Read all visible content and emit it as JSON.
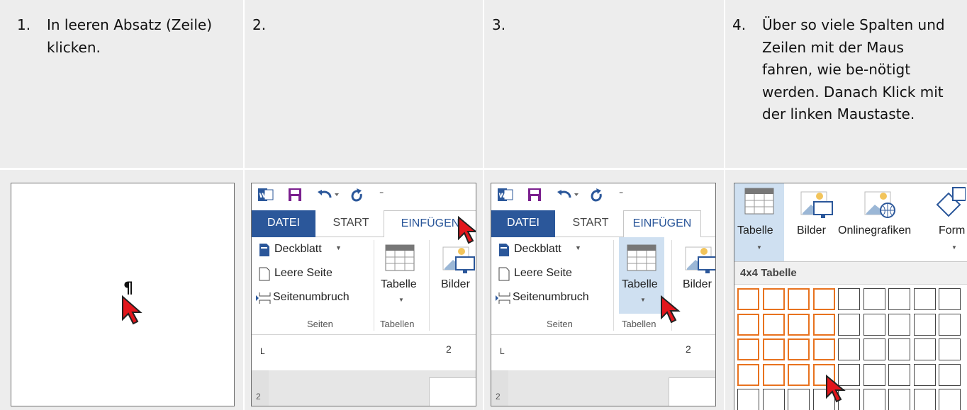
{
  "steps": [
    {
      "num": "1.",
      "text": "In leeren Absatz (Zeile) klicken."
    },
    {
      "num": "2.",
      "text": ""
    },
    {
      "num": "3.",
      "text": ""
    },
    {
      "num": "4.",
      "text": "Über so viele Spalten und Zeilen mit der Maus fahren, wie be-nötigt werden. Danach Klick mit der linken Maustaste."
    }
  ],
  "step1_shot": {
    "pilcrow": "¶"
  },
  "word": {
    "tabs": {
      "file": "DATEI",
      "start": "START",
      "insert": "EINFÜGEN"
    },
    "seiten_group": {
      "items": [
        "Deckblatt",
        "Leere Seite",
        "Seitenumbruch"
      ],
      "label": "Seiten"
    },
    "tabellen_group": {
      "button": "Tabelle",
      "label": "Tabellen"
    },
    "bilder": "Bilder",
    "ruler": {
      "marker": "L",
      "number": "2"
    },
    "side_ruler_number": "2"
  },
  "step4_shot": {
    "ribbon": [
      "Tabelle",
      "Bilder",
      "Onlinegrafiken",
      "Form"
    ],
    "grid_title": "4x4 Tabelle",
    "selection": {
      "cols": 4,
      "rows": 4
    }
  },
  "colors": {
    "accent_blue": "#2b579a",
    "selection_orange": "#e8721e",
    "cursor_red": "#e3161c",
    "panel_gray": "#ededed"
  },
  "icons": [
    "word-app-icon",
    "save-icon",
    "undo-icon",
    "redo-icon",
    "cover-page-icon",
    "blank-page-icon",
    "page-break-icon",
    "table-icon",
    "pictures-icon",
    "online-pictures-icon",
    "shapes-icon",
    "mouse-pointer-icon"
  ]
}
